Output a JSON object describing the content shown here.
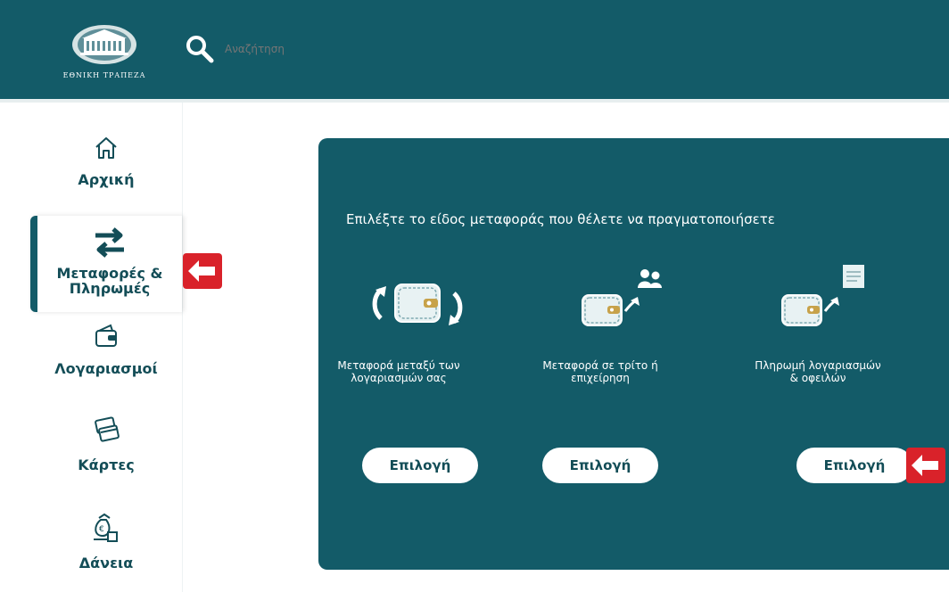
{
  "header": {
    "logo_text": "ΕΘΝΙΚΗ ΤΡΑΠΕΖΑ",
    "search_placeholder": "Αναζήτηση"
  },
  "sidebar": {
    "items": [
      {
        "label": "Αρχική",
        "icon": "home-icon"
      },
      {
        "label_line1": "Μεταφορές &",
        "label_line2": "Πληρωμές",
        "icon": "transfer-arrows-icon",
        "active": true
      },
      {
        "label": "Λογαριασμοί",
        "icon": "wallet-icon"
      },
      {
        "label": "Κάρτες",
        "icon": "cards-icon"
      },
      {
        "label": "Δάνεια",
        "icon": "loan-money-bag-icon"
      }
    ]
  },
  "main": {
    "title": "Επιλέξτε το είδος μεταφοράς που θέλετε να πραγματοποιήσετε",
    "options": [
      {
        "line1": "Μεταφορά μεταξύ των",
        "line2": "λογαριασμών σας",
        "button": "Επιλογή",
        "icon": "wallet-refresh-icon"
      },
      {
        "line1": "Μεταφορά σε τρίτο ή",
        "line2": "επιχείρηση",
        "button": "Επιλογή",
        "icon": "wallet-to-people-icon"
      },
      {
        "line1": "Πληρωμή λογαριασμών",
        "line2": "& οφειλών",
        "button": "Επιλογή",
        "icon": "wallet-to-bill-icon"
      }
    ]
  },
  "colors": {
    "brand_teal": "#135b68",
    "text_dark": "#134d57",
    "highlight_red": "#d9222a"
  }
}
